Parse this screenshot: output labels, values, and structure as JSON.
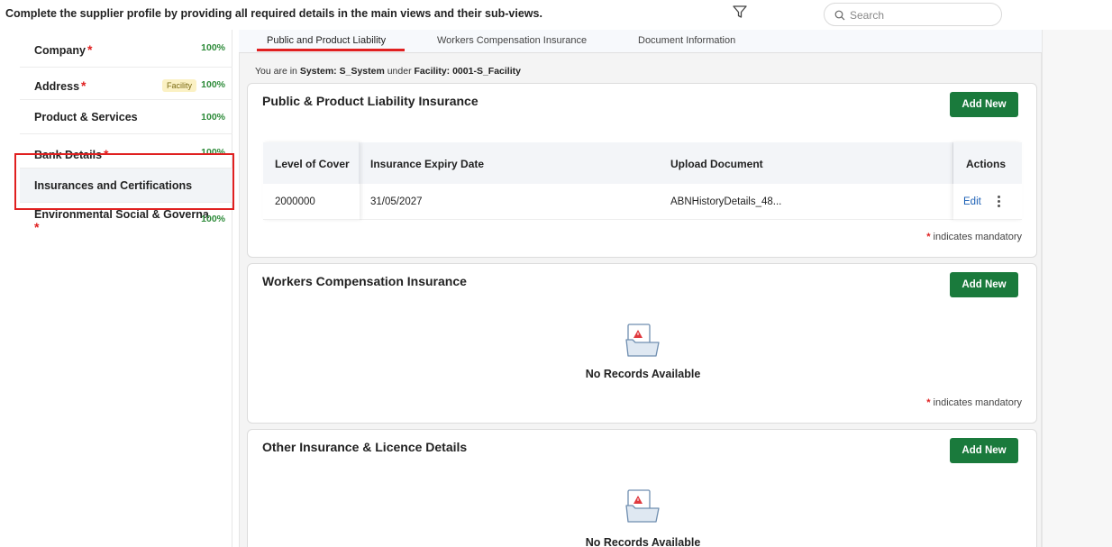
{
  "instruction": "Complete the supplier profile by providing all required details in the main views and their sub-views.",
  "search": {
    "placeholder": "Search"
  },
  "sidebar": {
    "items": [
      {
        "label": "Company",
        "required": "*",
        "percent": "100%"
      },
      {
        "label": "Address",
        "required": "*",
        "badge": "Facility",
        "percent": "100%"
      },
      {
        "label": "Product & Services",
        "percent": "100%"
      },
      {
        "label": "Bank Details",
        "required": "*",
        "percent": "100%"
      },
      {
        "label": "Insurances and Certifications"
      },
      {
        "label": "Environmental Social & Governa",
        "required": "*",
        "percent": "100%"
      }
    ]
  },
  "tabs": [
    {
      "label": "Public and Product Liability"
    },
    {
      "label": "Workers Compensation Insurance"
    },
    {
      "label": "Document Information"
    }
  ],
  "context": {
    "prefix": "You are in",
    "system_label": "System: S_System",
    "middle": "under",
    "facility_label": "Facility: 0001-S_Facility"
  },
  "cards": {
    "public": {
      "title": "Public & Product Liability Insurance",
      "add_label": "Add New",
      "columns": [
        "Level of Cover",
        "Insurance Expiry Date",
        "Upload Document",
        "Actions"
      ],
      "rows": [
        {
          "level": "2000000",
          "expiry": "31/05/2027",
          "document": "ABNHistoryDetails_48...",
          "edit": "Edit"
        }
      ],
      "mandatory_star": "*",
      "mandatory_text": "indicates mandatory"
    },
    "workers": {
      "title": "Workers Compensation Insurance",
      "add_label": "Add New",
      "empty_text": "No Records Available",
      "mandatory_star": "*",
      "mandatory_text": "indicates mandatory"
    },
    "other": {
      "title": "Other Insurance & Licence Details",
      "add_label": "Add New",
      "empty_text": "No Records Available"
    }
  },
  "colors": {
    "accent_green": "#1a7a3c",
    "percent_green": "#2e8b3a",
    "highlight_red": "#e02020",
    "link_blue": "#1b5fb5"
  }
}
